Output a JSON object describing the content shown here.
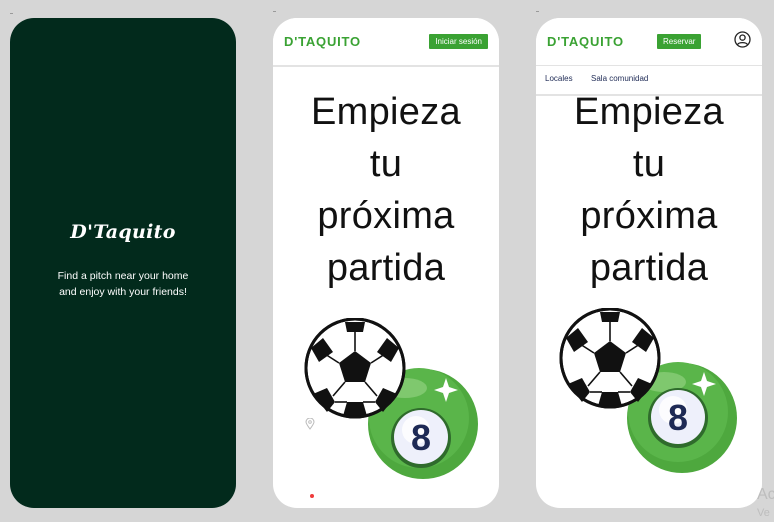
{
  "splash": {
    "logo": "D'Taquito",
    "tagline_line1": "Find a pitch near your home",
    "tagline_line2": "and enjoy with your friends!"
  },
  "screen_login": {
    "brand": "D'TAQUITO",
    "login_button": "Iniciar sesión",
    "headline": [
      "Empieza",
      "tu",
      "próxima",
      "partida"
    ]
  },
  "screen_home": {
    "brand": "D'TAQUITO",
    "reserve_button": "Reservar",
    "nav": [
      "Locales",
      "Sala comunidad"
    ],
    "headline": [
      "Empieza",
      "tu",
      "próxima",
      "partida"
    ]
  },
  "billiard_number": "8",
  "watermark": {
    "line1": "Ac",
    "line2": "Ve"
  },
  "colors": {
    "splash_bg": "#022a1c",
    "brand_green": "#3aa233",
    "ball_green": "#5ab54a",
    "page_bg": "#d6d6d6"
  },
  "icons": [
    "map-pin-icon",
    "user-circle-icon",
    "soccer-ball-icon",
    "billiard-ball-icon"
  ]
}
